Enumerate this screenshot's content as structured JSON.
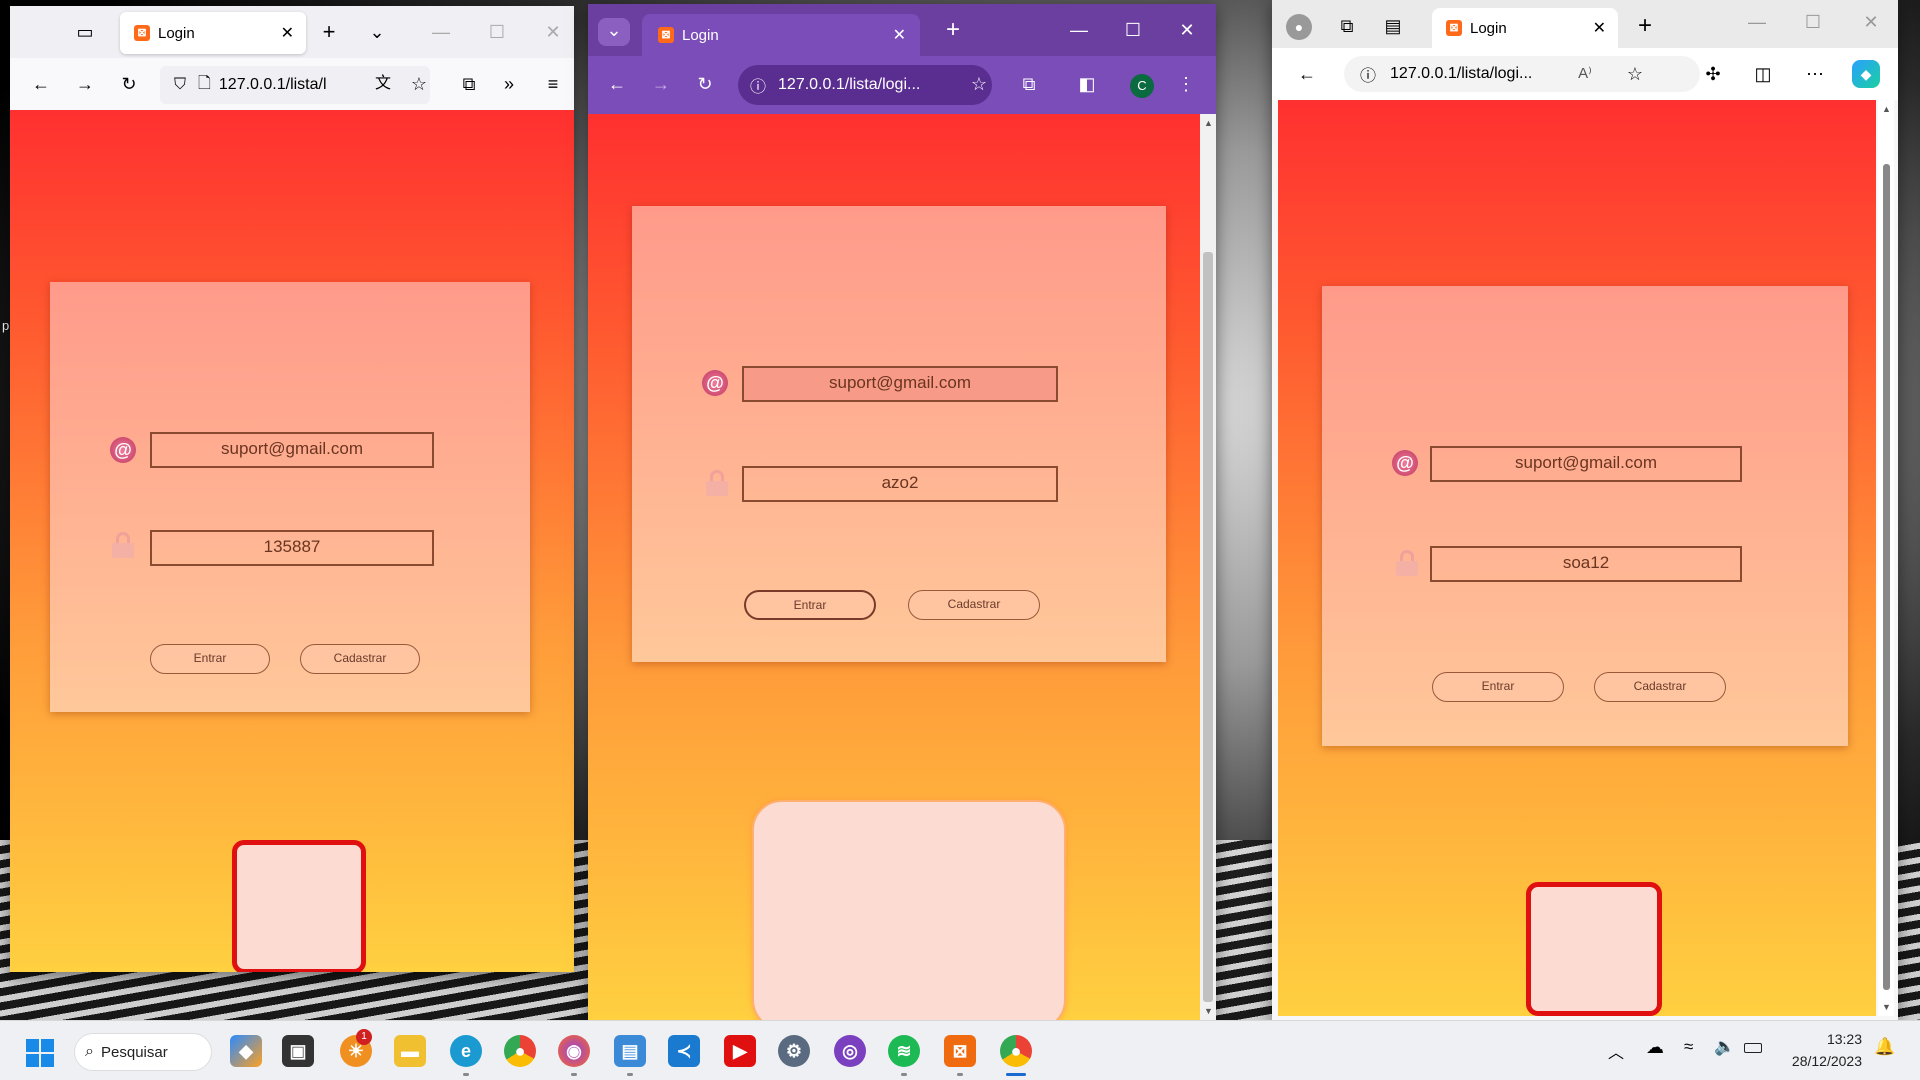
{
  "desktop": {
    "stray_text": "p"
  },
  "firefox": {
    "tab_title": "Login",
    "url": "127.0.0.1/lista/l",
    "email": "suport@gmail.com",
    "password": "135887",
    "enter_label": "Entrar",
    "register_label": "Cadastrar"
  },
  "chrome": {
    "tab_title": "Login",
    "url": "127.0.0.1/lista/logi...",
    "profile_initial": "C",
    "email": "suport@gmail.com",
    "password": "azo2",
    "enter_label": "Entrar",
    "register_label": "Cadastrar"
  },
  "edge": {
    "tab_title": "Login",
    "url": "127.0.0.1/lista/logi...",
    "read_aloud": "A⁾",
    "email": "suport@gmail.com",
    "password": "soa12",
    "enter_label": "Entrar",
    "register_label": "Cadastrar"
  },
  "taskbar": {
    "search_label": "Pesquisar",
    "notification_badge": "1",
    "time": "13:23",
    "date": "28/12/2023"
  },
  "colors": {
    "chrome_accent": "#6b3fa0",
    "page_top": "#ff3030",
    "page_bottom": "#ffd040"
  }
}
